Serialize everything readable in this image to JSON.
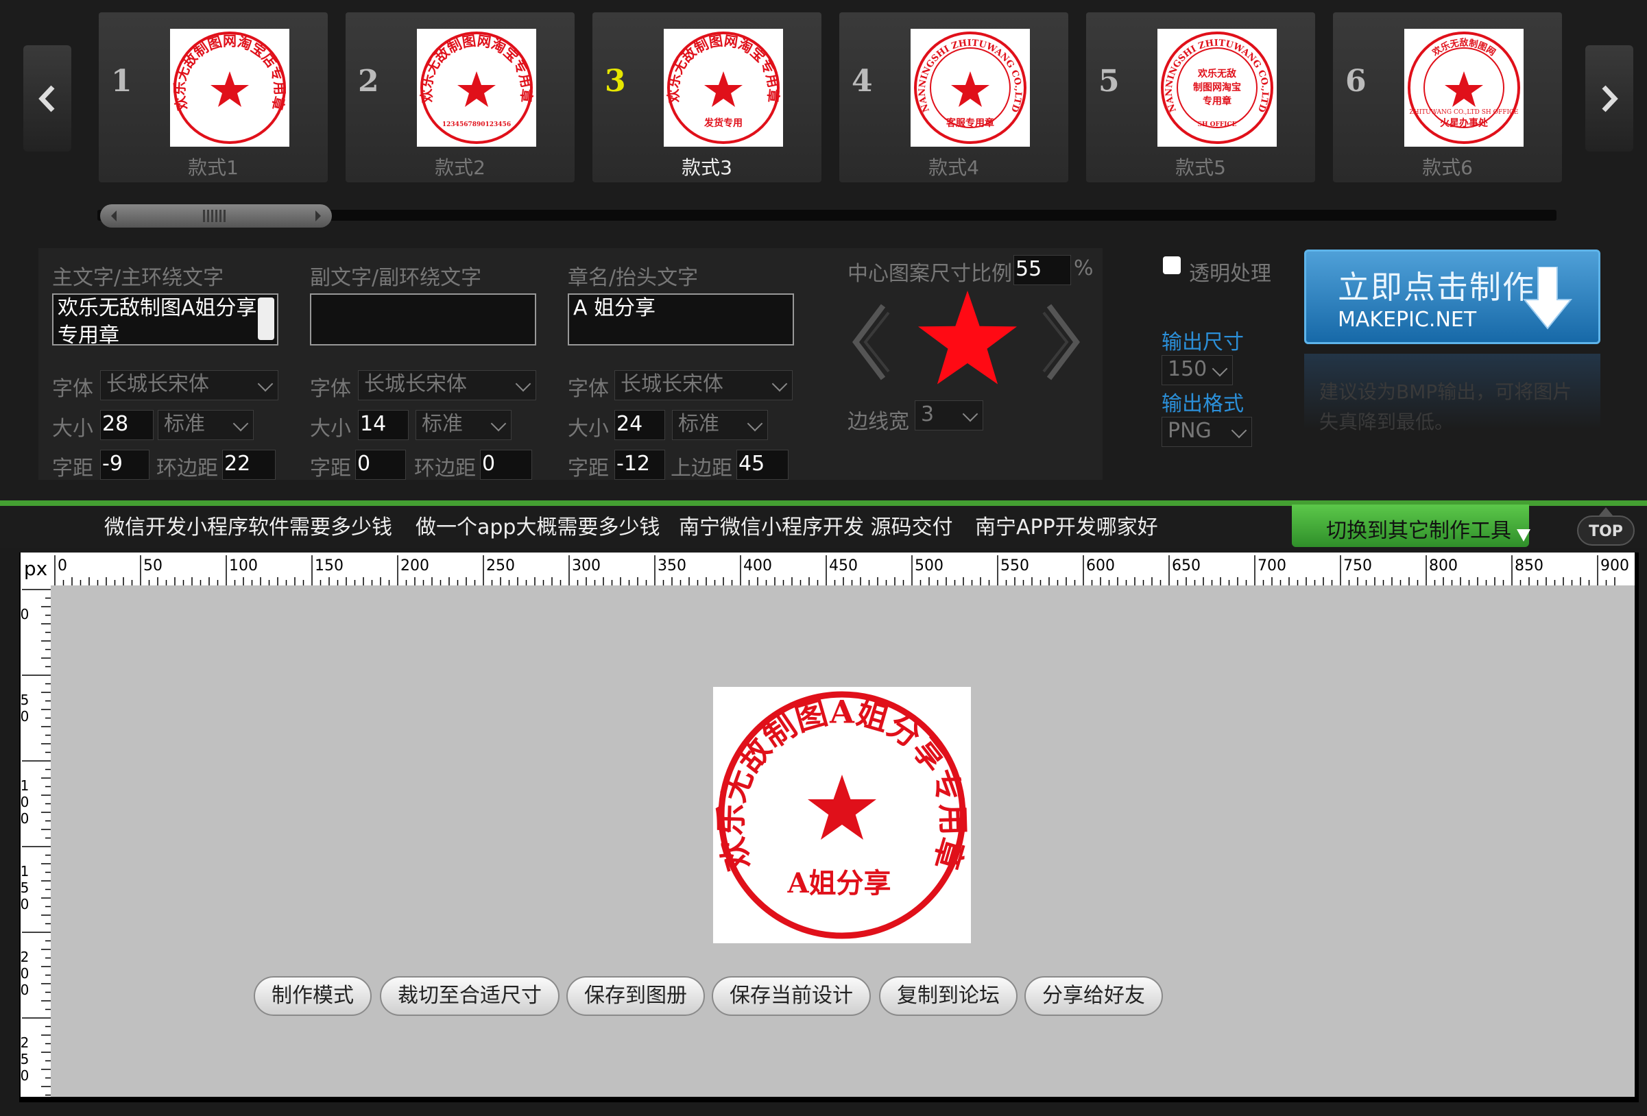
{
  "carousel": {
    "styles": [
      {
        "number": "1",
        "label": "款式1",
        "stamp_top": "欢乐无敌制图网淘宝店专用章",
        "stamp_bottom": "",
        "stamp_center": ""
      },
      {
        "number": "2",
        "label": "款式2",
        "stamp_top": "欢乐无敌制图网淘宝专用章",
        "stamp_bottom": "1234567890123456",
        "stamp_center": ""
      },
      {
        "number": "3",
        "label": "款式3",
        "stamp_top": "欢乐无敌制图网淘宝专用章",
        "stamp_bottom": "发货专用",
        "stamp_center": ""
      },
      {
        "number": "4",
        "label": "款式4",
        "stamp_top": "NANNINGSHI ZHITUWANG CO.,LTD",
        "stamp_bottom": "客服专用章",
        "stamp_center": ""
      },
      {
        "number": "5",
        "label": "款式5",
        "stamp_top": "NANNINGSHI ZHITUWANG CO.,LTD",
        "stamp_bottom": "SH OFFICE",
        "stamp_center": "欢乐无敌\n制图网淘宝\n专用章"
      },
      {
        "number": "6",
        "label": "款式6",
        "stamp_top": "欢乐无敌制图网",
        "stamp_bottom": "火星办事处",
        "stamp_center": "ZHITUWANG CO.,LTD SH OFFICE"
      }
    ],
    "active_index": 2
  },
  "main_text": {
    "title": "主文字/主环绕文字",
    "value": "欢乐无敌制图A姐分享专用章",
    "font_label": "字体",
    "font_value": "长城长宋体",
    "size_label": "大小",
    "size_value": "28",
    "weight_value": "标准",
    "spacing_label": "字距",
    "spacing_value": "-9",
    "margin_label": "环边距",
    "margin_value": "22"
  },
  "sub_text": {
    "title": "副文字/副环绕文字",
    "value": "",
    "font_label": "字体",
    "font_value": "长城长宋体",
    "size_label": "大小",
    "size_value": "14",
    "weight_value": "标准",
    "spacing_label": "字距",
    "spacing_value": "0",
    "margin_label": "环边距",
    "margin_value": "0"
  },
  "name_text": {
    "title": "章名/抬头文字",
    "value": "A 姐分享",
    "font_label": "字体",
    "font_value": "长城长宋体",
    "size_label": "大小",
    "size_value": "24",
    "weight_value": "标准",
    "spacing_label": "字距",
    "spacing_value": "-12",
    "margin_label": "上边距",
    "margin_value": "45"
  },
  "center": {
    "scale_label": "中心图案尺寸比例",
    "scale_value": "55",
    "scale_unit": "%",
    "border_label": "边线宽",
    "border_value": "3"
  },
  "output": {
    "transparent_label": "透明处理",
    "transparent_checked": false,
    "size_label": "输出尺寸",
    "size_value": "150",
    "format_label": "输出格式",
    "format_value": "PNG",
    "make_button_label": "立即点击制作",
    "make_button_sub": "MAKEPIC.NET",
    "hint": "建议设为BMP输出，可将图片失真降到最低。"
  },
  "links": [
    "微信开发小程序软件需要多少钱",
    "做一个app大概需要多少钱",
    "南宁微信小程序开发 源码交付",
    "南宁APP开发哪家好"
  ],
  "switch_tools_label": "切换到其它制作工具",
  "top_label": "TOP",
  "ruler": {
    "unit": "px",
    "h_ticks": [
      "0",
      "50",
      "100",
      "150",
      "200",
      "250",
      "300",
      "350",
      "400",
      "450",
      "500",
      "550",
      "600",
      "650",
      "700",
      "750",
      "800",
      "850",
      "900"
    ],
    "v_ticks": [
      "0",
      "50",
      "100",
      "150",
      "200",
      "250"
    ]
  },
  "preview": {
    "top_text": "欢乐无敌制图A姐分享专用章",
    "name_text": "A姐分享"
  },
  "tools": [
    "制作模式",
    "裁切至合适尺寸",
    "保存到图册",
    "保存当前设计",
    "复制到论坛",
    "分享给好友"
  ],
  "colors": {
    "stamp_red": "#e0101a",
    "accent_blue": "#2b8fd8",
    "accent_green": "#44a032",
    "active_yellow": "#e6e600"
  }
}
